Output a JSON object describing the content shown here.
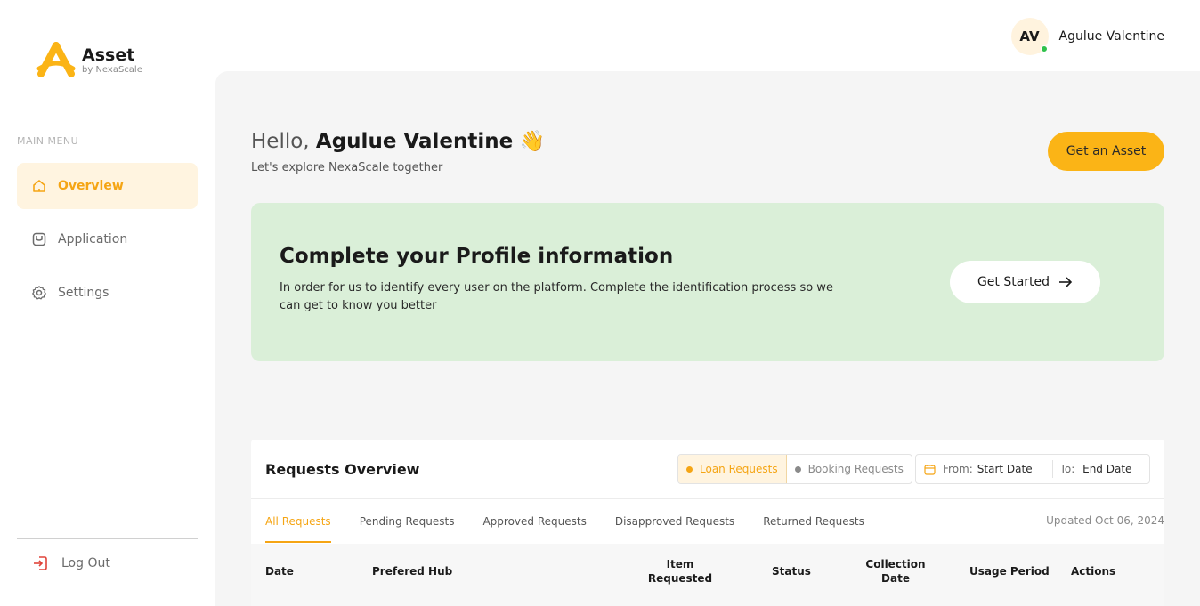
{
  "brand": {
    "name": "Asset",
    "tagline": "by NexaScale"
  },
  "sidebar": {
    "heading": "MAIN MENU",
    "items": [
      {
        "label": "Overview",
        "icon": "home-icon",
        "active": true
      },
      {
        "label": "Application",
        "icon": "application-icon",
        "active": false
      },
      {
        "label": "Settings",
        "icon": "gear-icon",
        "active": false
      }
    ],
    "logout_label": "Log Out"
  },
  "user": {
    "initials": "AV",
    "name": "Agulue Valentine",
    "online": true
  },
  "header": {
    "hello": "Hello,",
    "name": "Agulue Valentine",
    "wave": "👋",
    "subtitle": "Let's explore NexaScale together",
    "cta_label": "Get an Asset"
  },
  "banner": {
    "title": "Complete your Profile information",
    "text": "In order for us to identify every user on the platform. Complete the identification process so we can get to know you better",
    "button_label": "Get Started"
  },
  "requests": {
    "title": "Requests Overview",
    "toggle": [
      {
        "label": "Loan Requests",
        "active": true
      },
      {
        "label": "Booking Requests",
        "active": false
      }
    ],
    "date_range": {
      "from_label": "From:",
      "from_value": "Start Date",
      "to_label": "To:",
      "to_value": "End Date"
    },
    "tabs": [
      {
        "label": "All Requests",
        "active": true
      },
      {
        "label": "Pending Requests",
        "active": false
      },
      {
        "label": "Approved Requests",
        "active": false
      },
      {
        "label": "Disapproved Requests",
        "active": false
      },
      {
        "label": "Returned Requests",
        "active": false
      }
    ],
    "updated": "Updated Oct 06, 2024",
    "columns": [
      "Date",
      "Prefered Hub",
      "Item Requested",
      "Status",
      "Collection Date",
      "Usage Period",
      "Actions"
    ]
  },
  "colors": {
    "accent": "#fbb416",
    "accent_text": "#f5a514",
    "banner_bg": "#daefd8",
    "online": "#2fc14c",
    "logout": "#e0443a"
  }
}
